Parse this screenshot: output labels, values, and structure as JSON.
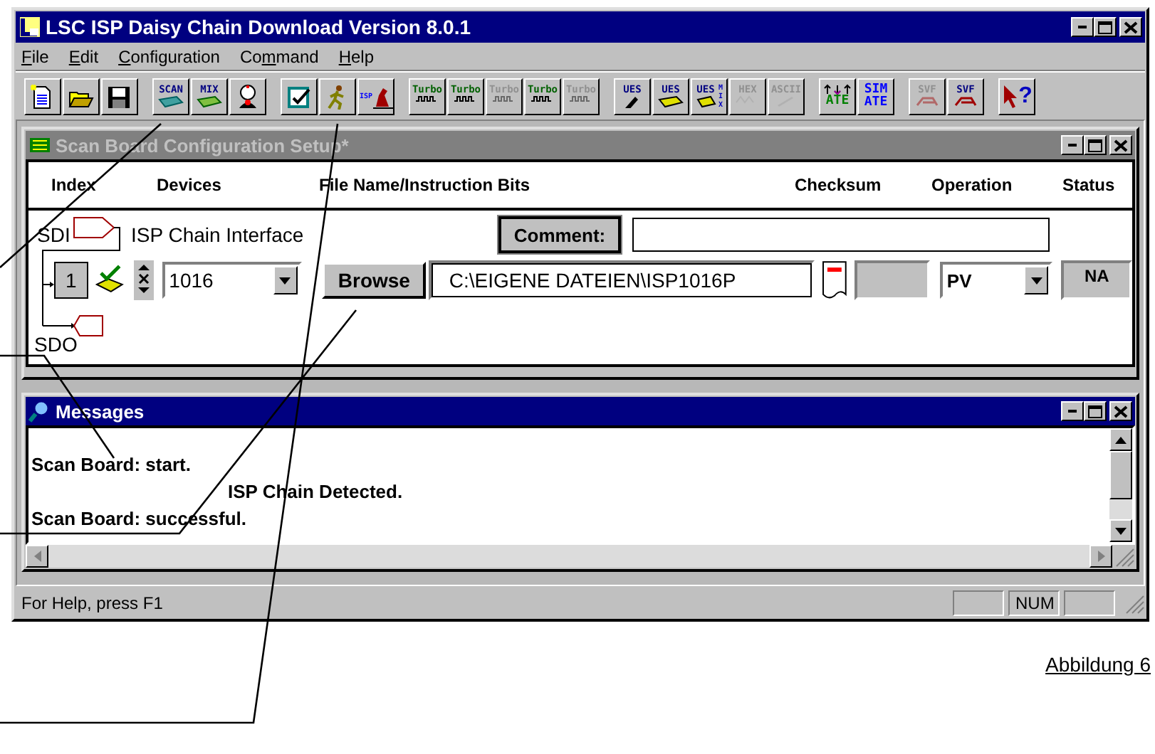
{
  "window": {
    "title": "LSC ISP Daisy Chain Download Version 8.0.1",
    "active": true
  },
  "menu": [
    {
      "key": "F",
      "post": "ile"
    },
    {
      "key": "E",
      "post": "dit"
    },
    {
      "key": "C",
      "post": "onfiguration"
    },
    {
      "pre": "Co",
      "key": "m",
      "post": "mand"
    },
    {
      "key": "H",
      "post": "elp"
    }
  ],
  "toolbar": [
    [
      {
        "kind": "new",
        "disabled": false
      },
      {
        "kind": "open",
        "disabled": false
      },
      {
        "kind": "save",
        "disabled": false
      }
    ],
    [
      {
        "kind": "scan",
        "label": "SCAN",
        "disabled": false
      },
      {
        "kind": "mix",
        "label": "MIX",
        "disabled": false
      },
      {
        "kind": "doctor",
        "disabled": false
      }
    ],
    [
      {
        "kind": "check",
        "disabled": false
      },
      {
        "kind": "run",
        "disabled": false
      },
      {
        "kind": "isp",
        "label": "ISP",
        "disabled": false
      }
    ],
    [
      {
        "kind": "turbo",
        "label": "Turbo",
        "disabled": false
      },
      {
        "kind": "turbo",
        "label": "Turbo",
        "disabled": false
      },
      {
        "kind": "turbo",
        "label": "Turbo",
        "disabled": true
      },
      {
        "kind": "turbo",
        "label": "Turbo",
        "disabled": false
      },
      {
        "kind": "turbo",
        "label": "Turbo",
        "disabled": true
      }
    ],
    [
      {
        "kind": "ues-edit",
        "label": "UES",
        "disabled": false
      },
      {
        "kind": "ues",
        "label": "UES",
        "disabled": false
      },
      {
        "kind": "ues-mix",
        "label": "UES",
        "sub": "MIX",
        "disabled": false
      },
      {
        "kind": "hex",
        "label": "HEX",
        "disabled": true
      },
      {
        "kind": "ascii",
        "label": "ASCII",
        "disabled": true
      }
    ],
    [
      {
        "kind": "ate",
        "label": "ATE",
        "disabled": false
      },
      {
        "kind": "sim-ate",
        "label": "SIM",
        "sub": "ATE",
        "disabled": false
      }
    ],
    [
      {
        "kind": "svf",
        "label": "SVF",
        "disabled": true
      },
      {
        "kind": "svf",
        "label": "SVF",
        "disabled": false
      }
    ],
    [
      {
        "kind": "help",
        "label": "?",
        "disabled": false
      }
    ]
  ],
  "scan_window": {
    "title": "Scan Board Configuration Setup*",
    "active": false,
    "columns": [
      "Index",
      "Devices",
      "File Name/Instruction Bits",
      "Checksum",
      "Operation",
      "Status"
    ],
    "input_label": "SDI",
    "chain_label": "ISP Chain Interface",
    "comment_button": "Comment:",
    "device": {
      "index": "1",
      "device": "1016",
      "browse": "Browse",
      "file": "C:\\EIGENE DATEIEN\\ISP1016P",
      "operation": "PV",
      "status": "NA"
    },
    "output_label": "SDO"
  },
  "messages_window": {
    "title": "Messages",
    "active": true,
    "lines": [
      {
        "text": "Scan Board: start.",
        "indented": false
      },
      {
        "text": "ISP Chain Detected.",
        "indented": true
      },
      {
        "text": "Scan Board: successful.",
        "indented": false
      }
    ]
  },
  "status_bar": {
    "text": "For Help, press F1",
    "indicators": [
      "NUM"
    ]
  },
  "caption": "Abbildung 6"
}
